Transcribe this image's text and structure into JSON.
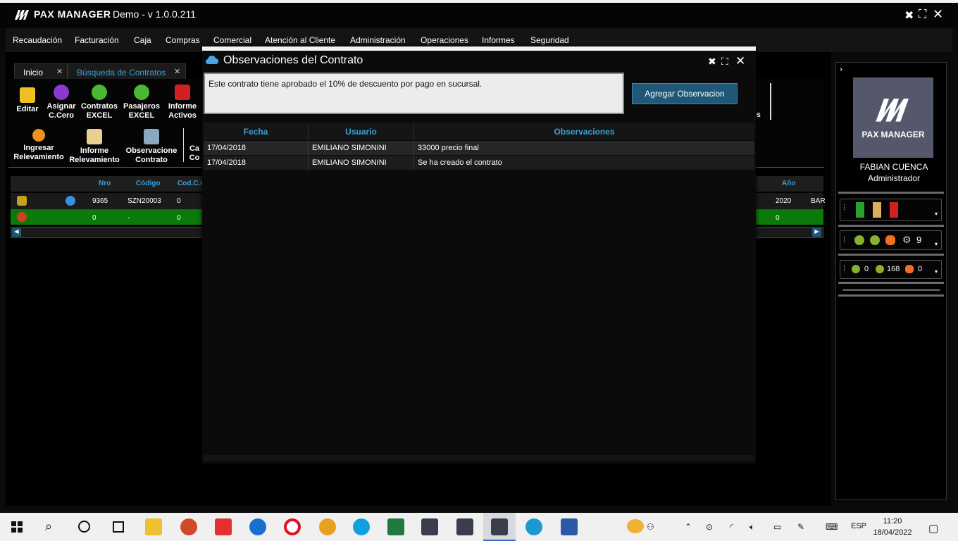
{
  "app": {
    "brand": "PAX MANAGER",
    "title": "Demo - v 1.0.0.211"
  },
  "menu": [
    "Recaudación",
    "Facturación",
    "Caja",
    "Compras",
    "Comercial",
    "Atención al Cliente",
    "Administración",
    "Operaciones",
    "Informes",
    "Seguridad"
  ],
  "tabs": [
    {
      "label": "Inicio"
    },
    {
      "label": "Búsqueda de Contratos"
    }
  ],
  "toolbar_row1": [
    {
      "label": "Editar"
    },
    {
      "label": "Asignar C.Cero"
    },
    {
      "label": "Contratos EXCEL"
    },
    {
      "label": "Pasajeros EXCEL"
    },
    {
      "label": "Informe Activos"
    }
  ],
  "toolbar_row2": [
    {
      "label": "Ingresar Relevamiento"
    },
    {
      "label": "Informe Relevamiento"
    },
    {
      "label": "Observacione Contrato"
    },
    {
      "label": "Ca Co"
    }
  ],
  "toolbar_partial_right": "os",
  "grid": {
    "headers": {
      "nro": "Nro",
      "codigo": "Código",
      "codcc": "Cod.C.C",
      "anio": "Año"
    },
    "rows": [
      {
        "nro": "9365",
        "codigo": "SZN20003",
        "codcc": "0",
        "anio": "2020",
        "extra": "BAR"
      },
      {
        "nro": "0",
        "codigo": "-",
        "codcc": "0",
        "anio": "0",
        "extra": ""
      }
    ]
  },
  "user_panel": {
    "brand": "PAX MANAGER",
    "name": "FABIAN CUENCA",
    "role": "Administrador",
    "box2_count": "9",
    "box3_a": "0",
    "box3_b": "168",
    "box3_c": "0"
  },
  "modal": {
    "title": "Observaciones del Contrato",
    "input_value": "Este contrato tiene aprobado el 10% de descuento por pago en sucursal.",
    "add_button": "Agregar Observacion",
    "headers": {
      "fecha": "Fecha",
      "usuario": "Usuario",
      "observaciones": "Observaciones"
    },
    "rows": [
      {
        "fecha": "17/04/2018",
        "usuario": "EMILIANO SIMONINI",
        "obs": "33000 precio final"
      },
      {
        "fecha": "17/04/2018",
        "usuario": "EMILIANO SIMONINI",
        "obs": "Se ha creado el contrato"
      }
    ]
  },
  "taskbar": {
    "language": "ESP",
    "time": "11:20",
    "date": "18/04/2022"
  },
  "colors": {
    "accent": "#3aa0d6",
    "button": "#1f5877",
    "green_row": "#0a7a0a"
  }
}
